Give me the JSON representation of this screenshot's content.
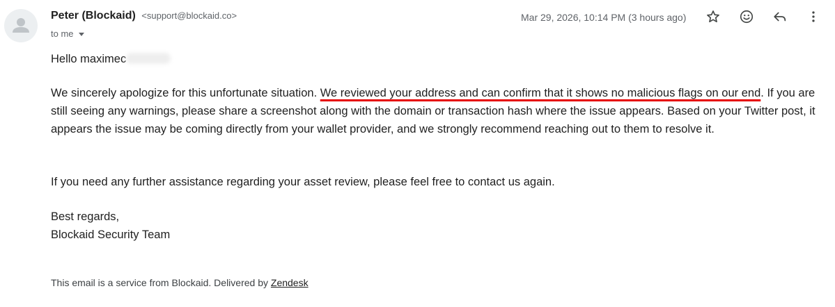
{
  "sender": {
    "name": "Peter (Blockaid)",
    "email": "<support@blockaid.co>",
    "recipient": "to me"
  },
  "timestamp": "Mar 29, 2026, 10:14 PM (3 hours ago)",
  "actions": [
    "star-icon",
    "emoji-icon",
    "reply-icon",
    "more-vert-icon"
  ],
  "body": {
    "greeting": "Hello maximec",
    "main_intro": "We sincerely apologize for this unfortunate situation. ",
    "main_highlight": "We reviewed your address and can confirm that it shows no malicious flags on our end",
    "main_rest": ". If you are still seeing any warnings, please share a screenshot along with the domain or transaction hash where the issue appears. Based on your Twitter post, it appears the issue may be coming directly from your wallet provider, and we strongly recommend reaching out to them to resolve it.",
    "help": "If you need any further assistance regarding your asset review, please feel free to contact us again.",
    "closing": "Best regards,",
    "signature": "Blockaid Security Team"
  },
  "footer": {
    "text": "This email is a service from Blockaid. Delivered by ",
    "link": "Zendesk"
  },
  "colors": {
    "highlight_underline": "#e60000",
    "secondary_text": "#5f6368"
  }
}
